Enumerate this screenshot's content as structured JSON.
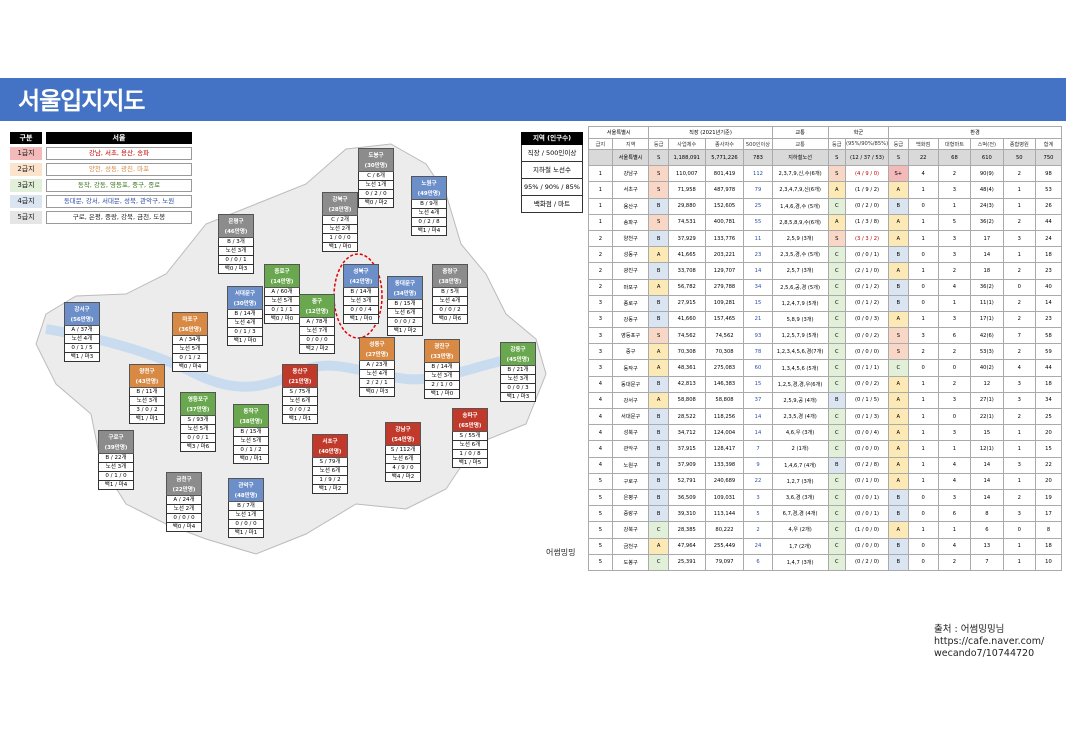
{
  "title": "서울입지지도",
  "legend": {
    "head_key": "구분",
    "head_val": "서울",
    "rows": [
      {
        "key": "1급지",
        "val": "강남, 서초, 용산, 송파",
        "color": "#f4b9b9",
        "text_color": "#c00000"
      },
      {
        "key": "2급지",
        "val": "양천, 성동, 광진, 마포",
        "color": "#fce4cc",
        "text_color": "#d88a45"
      },
      {
        "key": "3급지",
        "val": "동작, 강동, 영등포, 중구, 종로",
        "color": "#e2efd9",
        "text_color": "#38761d"
      },
      {
        "key": "4급지",
        "val": "동대문, 강서, 서대문, 성북, 관악구, 노원",
        "color": "#dbe5f1",
        "text_color": "#2f4fa5"
      },
      {
        "key": "5급지",
        "val": "구로, 은평, 중랑, 강북, 금천, 도봉",
        "color": "#e5e5e5",
        "text_color": "#222222"
      }
    ]
  },
  "side_legend": {
    "head": "지역 (인구수)",
    "items": [
      "직장 / 500인이상",
      "지하철 노선수",
      "95% / 90% / 85%",
      "백화점 / 마트"
    ]
  },
  "districts": [
    {
      "name": "도봉구",
      "pop": "(30만명)",
      "lines": [
        "C / 6개",
        "노선 1개",
        "0 / 2 / 0",
        "백0 / 마2"
      ],
      "grade": "g5"
    },
    {
      "name": "노원구",
      "pop": "(49만명)",
      "lines": [
        "B / 9개",
        "노선 4개",
        "0 / 2 / 8",
        "백1 / 마4"
      ],
      "grade": "g4"
    },
    {
      "name": "강북구",
      "pop": "(28만명)",
      "lines": [
        "C / 2개",
        "노선 2개",
        "1 / 0 / 0",
        "백1 / 마0"
      ],
      "grade": "g5"
    },
    {
      "name": "은평구",
      "pop": "(46만명)",
      "lines": [
        "B / 3개",
        "노선 3개",
        "0 / 0 / 1",
        "백0 / 마3"
      ],
      "grade": "g5"
    },
    {
      "name": "종로구",
      "pop": "(14만명)",
      "lines": [
        "A / 60개",
        "노선 5개",
        "0 / 1 / 1",
        "백0 / 마0"
      ],
      "grade": "g3"
    },
    {
      "name": "성북구",
      "pop": "(42만명)",
      "lines": [
        "B / 14개",
        "노선 3개",
        "0 / 0 / 4",
        "백1 / 마0"
      ],
      "grade": "g4"
    },
    {
      "name": "동대문구",
      "pop": "(34만명)",
      "lines": [
        "B / 15개",
        "노선 6개",
        "0 / 0 / 2",
        "백1 / 마2"
      ],
      "grade": "g4"
    },
    {
      "name": "중랑구",
      "pop": "(38만명)",
      "lines": [
        "B / 5개",
        "노선 4개",
        "0 / 0 / 2",
        "백0 / 마6"
      ],
      "grade": "g5"
    },
    {
      "name": "강서구",
      "pop": "(56만명)",
      "lines": [
        "A / 37개",
        "노선 4개",
        "0 / 1 / 5",
        "백1 / 마3"
      ],
      "grade": "g4"
    },
    {
      "name": "마포구",
      "pop": "(36만명)",
      "lines": [
        "A / 34개",
        "노선 5개",
        "0 / 1 / 2",
        "백0 / 마4"
      ],
      "grade": "g2"
    },
    {
      "name": "서대문구",
      "pop": "(30만명)",
      "lines": [
        "B / 14개",
        "노선 4개",
        "0 / 1 / 3",
        "백1 / 마0"
      ],
      "grade": "g4"
    },
    {
      "name": "중구",
      "pop": "(12만명)",
      "lines": [
        "A / 78개",
        "노선 7개",
        "0 / 0 / 0",
        "백2 / 마2"
      ],
      "grade": "g3"
    },
    {
      "name": "성동구",
      "pop": "(27만명)",
      "lines": [
        "A / 23개",
        "노선 4개",
        "2 / 2 / 1",
        "백0 / 마3"
      ],
      "grade": "g2"
    },
    {
      "name": "광진구",
      "pop": "(33만명)",
      "lines": [
        "B / 14개",
        "노선 3개",
        "2 / 1 / 0",
        "백1 / 마0"
      ],
      "grade": "g2"
    },
    {
      "name": "강동구",
      "pop": "(45만명)",
      "lines": [
        "B / 21개",
        "노선 3개",
        "0 / 0 / 3",
        "백1 / 마3"
      ],
      "grade": "g3"
    },
    {
      "name": "양천구",
      "pop": "(43만명)",
      "lines": [
        "B / 11개",
        "노선 3개",
        "3 / 0 / 2",
        "백1 / 마1"
      ],
      "grade": "g2"
    },
    {
      "name": "영등포구",
      "pop": "(37만명)",
      "lines": [
        "S / 93개",
        "노선 5개",
        "0 / 0 / 1",
        "백3 / 마6"
      ],
      "grade": "g3"
    },
    {
      "name": "용산구",
      "pop": "(21만명)",
      "lines": [
        "S / 75개",
        "노선 6개",
        "0 / 0 / 2",
        "백1 / 마1"
      ],
      "grade": "g1"
    },
    {
      "name": "동작구",
      "pop": "(38만명)",
      "lines": [
        "B / 15개",
        "노선 5개",
        "0 / 1 / 2",
        "백0 / 마1"
      ],
      "grade": "g3"
    },
    {
      "name": "구로구",
      "pop": "(39만명)",
      "lines": [
        "B / 22개",
        "노선 3개",
        "0 / 1 / 0",
        "백1 / 마4"
      ],
      "grade": "g5"
    },
    {
      "name": "서초구",
      "pop": "(40만명)",
      "lines": [
        "S / 79개",
        "노선 6개",
        "1 / 9 / 2",
        "백1 / 마2"
      ],
      "grade": "g1"
    },
    {
      "name": "강남구",
      "pop": "(54만명)",
      "lines": [
        "S / 112개",
        "노선 6개",
        "4 / 9 / 0",
        "백4 / 마2"
      ],
      "grade": "g1"
    },
    {
      "name": "송파구",
      "pop": "(65만명)",
      "lines": [
        "S / 55개",
        "노선 6개",
        "1 / 0 / 8",
        "백1 / 마5"
      ],
      "grade": "g1"
    },
    {
      "name": "금천구",
      "pop": "(22만명)",
      "lines": [
        "A / 24개",
        "노선 2개",
        "0 / 0 / 0",
        "백0 / 마4"
      ],
      "grade": "g5"
    },
    {
      "name": "관악구",
      "pop": "(48만명)",
      "lines": [
        "B / 7개",
        "노선 1개",
        "0 / 0 / 0",
        "백1 / 마1"
      ],
      "grade": "g4"
    }
  ],
  "map_watermark": "어썸밍밍",
  "table": {
    "group_headers": [
      "서울특별시",
      "직장 (2021년기준)",
      "교통",
      "학군",
      "환경"
    ],
    "sub_headers": [
      "급지",
      "지역",
      "등급",
      "사업체수",
      "종사자수",
      "500인이상",
      "교통",
      "등급",
      "(95%/90%/85%)",
      "등급",
      "백화점",
      "대형마트",
      "스벅(전)",
      "종합병원",
      "합계"
    ],
    "rows": [
      [
        "",
        "서울특별시",
        "S",
        "1,188,091",
        "5,771,226",
        "783",
        "지하철노선",
        "S",
        "(12 / 37 / 53)",
        "S",
        "22",
        "68",
        "610",
        "50",
        "750"
      ],
      [
        "1",
        "강남구",
        "S",
        "110,007",
        "801,419",
        "112",
        "2,3,7,9,신,수(6개)",
        "S",
        "(4 / 9 / 0)",
        "S+",
        "4",
        "2",
        "90(9)",
        "2",
        "98"
      ],
      [
        "1",
        "서초구",
        "S",
        "71,958",
        "487,978",
        "79",
        "2,3,4,7,9,신(6개)",
        "A",
        "(1 / 9 / 2)",
        "A",
        "1",
        "3",
        "48(4)",
        "1",
        "53"
      ],
      [
        "1",
        "용산구",
        "B",
        "29,880",
        "152,605",
        "25",
        "1,4,6,경,수 (5개)",
        "C",
        "(0 / 2 / 0)",
        "B",
        "0",
        "1",
        "24(3)",
        "1",
        "26"
      ],
      [
        "1",
        "송파구",
        "S",
        "74,531",
        "400,781",
        "55",
        "2,8,5,8,9,수(6개)",
        "A",
        "(1 / 3 / 8)",
        "A",
        "1",
        "5",
        "36(2)",
        "2",
        "44"
      ],
      [
        "2",
        "양천구",
        "B",
        "37,929",
        "133,776",
        "11",
        "2,5,9 (3개)",
        "S",
        "(3 / 3 / 2)",
        "A",
        "1",
        "3",
        "17",
        "3",
        "24"
      ],
      [
        "2",
        "성동구",
        "A",
        "41,665",
        "203,221",
        "23",
        "2,3,5,경,수 (5개)",
        "C",
        "(0 / 0 / 1)",
        "B",
        "0",
        "3",
        "14",
        "1",
        "18"
      ],
      [
        "2",
        "광진구",
        "B",
        "33,708",
        "129,707",
        "14",
        "2,5,7 (3개)",
        "C",
        "(2 / 1 / 0)",
        "A",
        "1",
        "2",
        "18",
        "2",
        "23"
      ],
      [
        "2",
        "마포구",
        "A",
        "56,782",
        "279,788",
        "34",
        "2,5,6,공,경 (5개)",
        "C",
        "(0 / 1 / 2)",
        "B",
        "0",
        "4",
        "36(2)",
        "0",
        "40"
      ],
      [
        "3",
        "종로구",
        "B",
        "27,915",
        "109,281",
        "15",
        "1,2,4,7,9 (5개)",
        "C",
        "(0 / 1 / 2)",
        "B",
        "0",
        "1",
        "11(1)",
        "2",
        "14"
      ],
      [
        "3",
        "강동구",
        "B",
        "41,660",
        "157,465",
        "21",
        "5,8,9 (3개)",
        "C",
        "(0 / 0 / 3)",
        "A",
        "1",
        "3",
        "17(1)",
        "2",
        "23"
      ],
      [
        "3",
        "영등포구",
        "S",
        "74,562",
        "74,562",
        "93",
        "1,2,5,7,9 (5개)",
        "C",
        "(0 / 0 / 2)",
        "S",
        "3",
        "6",
        "42(6)",
        "7",
        "58"
      ],
      [
        "3",
        "중구",
        "A",
        "70,308",
        "70,308",
        "78",
        "1,2,3,4,5,6,경(7개)",
        "C",
        "(0 / 0 / 0)",
        "S",
        "2",
        "2",
        "53(3)",
        "2",
        "59"
      ],
      [
        "3",
        "동작구",
        "A",
        "48,361",
        "275,083",
        "60",
        "1,3,4,5,6 (5개)",
        "C",
        "(0 / 1 / 1)",
        "C",
        "0",
        "0",
        "40(2)",
        "4",
        "44"
      ],
      [
        "4",
        "동대문구",
        "B",
        "42,813",
        "146,383",
        "15",
        "1,2,5,경,경,우(6개)",
        "C",
        "(0 / 0 / 2)",
        "A",
        "1",
        "2",
        "12",
        "3",
        "18"
      ],
      [
        "4",
        "강서구",
        "A",
        "58,808",
        "58,808",
        "37",
        "2,5,9,공 (4개)",
        "B",
        "(0 / 1 / 5)",
        "A",
        "1",
        "3",
        "27(1)",
        "3",
        "34"
      ],
      [
        "4",
        "서대문구",
        "B",
        "28,522",
        "118,256",
        "14",
        "2,3,5,경 (4개)",
        "C",
        "(0 / 1 / 3)",
        "A",
        "1",
        "0",
        "22(1)",
        "2",
        "25"
      ],
      [
        "4",
        "성북구",
        "B",
        "34,712",
        "124,004",
        "14",
        "4,6,우 (3개)",
        "C",
        "(0 / 0 / 4)",
        "A",
        "1",
        "3",
        "15",
        "1",
        "20"
      ],
      [
        "4",
        "관악구",
        "B",
        "37,915",
        "128,417",
        "7",
        "2 (1개)",
        "C",
        "(0 / 0 / 0)",
        "A",
        "1",
        "1",
        "12(1)",
        "1",
        "15"
      ],
      [
        "4",
        "노원구",
        "B",
        "37,909",
        "133,398",
        "9",
        "1,4,6,7 (4개)",
        "B",
        "(0 / 2 / 8)",
        "A",
        "1",
        "4",
        "14",
        "3",
        "22"
      ],
      [
        "5",
        "구로구",
        "B",
        "52,791",
        "240,689",
        "22",
        "1,2,7 (3개)",
        "C",
        "(0 / 1 / 0)",
        "A",
        "1",
        "4",
        "14",
        "1",
        "20"
      ],
      [
        "5",
        "은평구",
        "B",
        "36,509",
        "109,031",
        "3",
        "3,6,경 (3개)",
        "C",
        "(0 / 0 / 1)",
        "B",
        "0",
        "3",
        "14",
        "2",
        "19"
      ],
      [
        "5",
        "중랑구",
        "B",
        "39,310",
        "113,144",
        "5",
        "6,7,경,경 (4개)",
        "C",
        "(0 / 0 / 1)",
        "B",
        "0",
        "6",
        "8",
        "3",
        "17"
      ],
      [
        "5",
        "강북구",
        "C",
        "28,385",
        "80,222",
        "2",
        "4,우 (2개)",
        "C",
        "(1 / 0 / 0)",
        "A",
        "1",
        "1",
        "6",
        "0",
        "8"
      ],
      [
        "5",
        "금천구",
        "A",
        "47,964",
        "255,449",
        "24",
        "1,7 (2개)",
        "C",
        "(0 / 0 / 0)",
        "B",
        "0",
        "4",
        "13",
        "1",
        "18"
      ],
      [
        "5",
        "도봉구",
        "C",
        "25,391",
        "79,097",
        "6",
        "1,4,7 (3개)",
        "C",
        "(0 / 2 / 0)",
        "B",
        "0",
        "2",
        "7",
        "1",
        "10"
      ]
    ]
  },
  "credit": {
    "line1": "출처 : 어썸밍밍님",
    "line2": "https://cafe.naver.com/",
    "line3": "wecando7/10744720"
  }
}
